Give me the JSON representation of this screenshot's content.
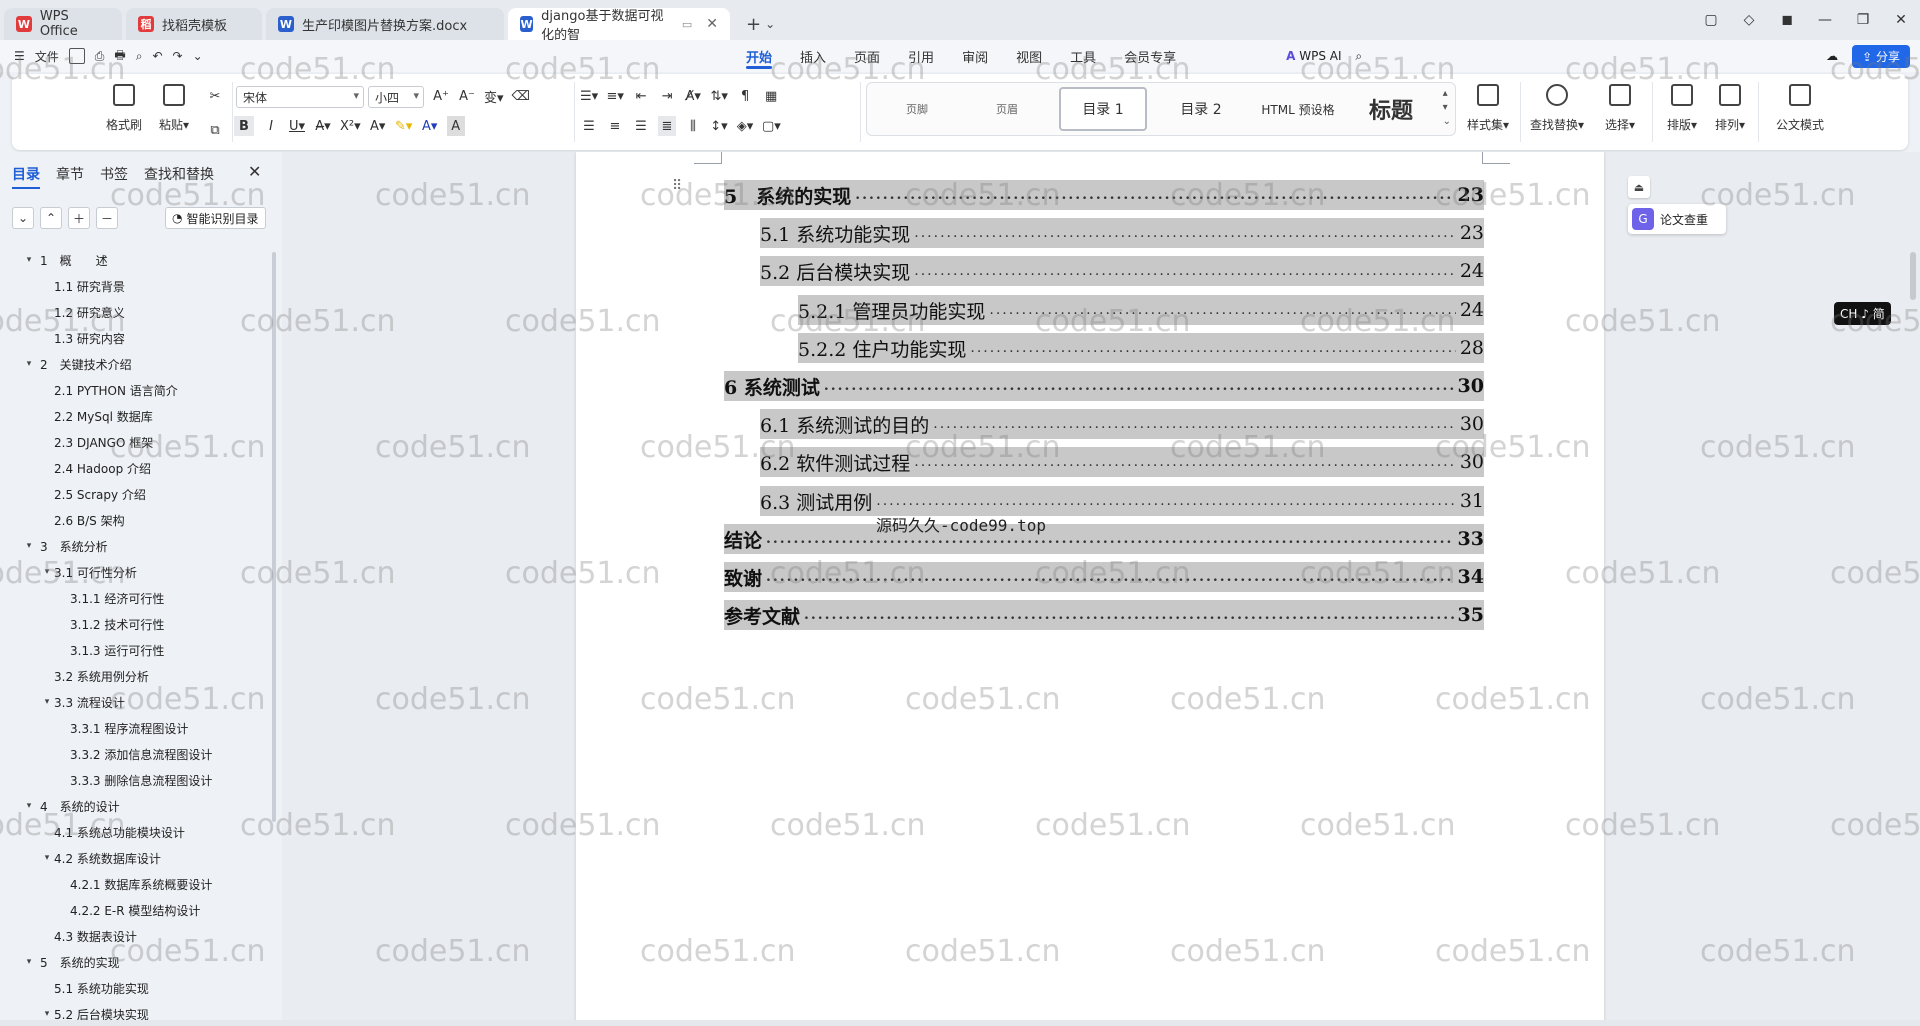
{
  "tabs": [
    {
      "label": "WPS Office",
      "logo": "W",
      "color": "#e23b3b",
      "active": false
    },
    {
      "label": "找稻壳模板",
      "logo": "稻",
      "color": "#e23b3b",
      "active": false
    },
    {
      "label": "生产印模图片替换方案.docx",
      "logo": "W",
      "color": "#2b5fce",
      "active": false
    },
    {
      "label": "django基于数据可视化的智",
      "logo": "W",
      "color": "#2b5fce",
      "active": true
    }
  ],
  "menu": {
    "file": "文件",
    "tabs": [
      "开始",
      "插入",
      "页面",
      "引用",
      "审阅",
      "视图",
      "工具",
      "会员专享"
    ],
    "wps_ai": "WPS AI",
    "share": "分享"
  },
  "ribbon": {
    "format_painter": "格式刷",
    "paste": "粘贴",
    "font_name": "宋体",
    "font_size": "小四",
    "styles": [
      "页脚",
      "页眉",
      "目录 1",
      "目录 2",
      "HTML 预设格",
      "标题"
    ],
    "style_set": "样式集",
    "find_replace": "查找替换",
    "select": "选择",
    "layout": "排版",
    "arrange": "排列",
    "official": "公文模式"
  },
  "nav": {
    "tabs": [
      "目录",
      "章节",
      "书签",
      "查找和替换"
    ],
    "smart": "智能识别目录",
    "outline": [
      {
        "text": "1　概　　述",
        "level": 1,
        "tri": true
      },
      {
        "text": "1.1 研究背景",
        "level": 2,
        "tri": false
      },
      {
        "text": "1.2 研究意义",
        "level": 2,
        "tri": false
      },
      {
        "text": "1.3 研究内容",
        "level": 2,
        "tri": false
      },
      {
        "text": "2　关键技术介绍",
        "level": 1,
        "tri": true
      },
      {
        "text": "2.1 PYTHON 语言简介",
        "level": 2,
        "tri": false
      },
      {
        "text": "2.2 MySql 数据库",
        "level": 2,
        "tri": false
      },
      {
        "text": "2.3 DJANGO 框架",
        "level": 2,
        "tri": false
      },
      {
        "text": "2.4 Hadoop 介绍",
        "level": 2,
        "tri": false
      },
      {
        "text": "2.5 Scrapy 介绍",
        "level": 2,
        "tri": false
      },
      {
        "text": "2.6 B/S 架构",
        "level": 2,
        "tri": false
      },
      {
        "text": "3　系统分析",
        "level": 1,
        "tri": true
      },
      {
        "text": "3.1 可行性分析",
        "level": 2,
        "tri": true
      },
      {
        "text": "3.1.1 经济可行性",
        "level": 3,
        "tri": false
      },
      {
        "text": "3.1.2 技术可行性",
        "level": 3,
        "tri": false
      },
      {
        "text": "3.1.3 运行可行性",
        "level": 3,
        "tri": false
      },
      {
        "text": "3.2 系统用例分析",
        "level": 2,
        "tri": false
      },
      {
        "text": "3.3 流程设计",
        "level": 2,
        "tri": true
      },
      {
        "text": "3.3.1 程序流程图设计",
        "level": 3,
        "tri": false
      },
      {
        "text": "3.3.2 添加信息流程图设计",
        "level": 3,
        "tri": false
      },
      {
        "text": "3.3.3 删除信息流程图设计",
        "level": 3,
        "tri": false
      },
      {
        "text": "4　系统的设计",
        "level": 1,
        "tri": true
      },
      {
        "text": "4.1 系统总功能模块设计",
        "level": 2,
        "tri": false
      },
      {
        "text": "4.2 系统数据库设计",
        "level": 2,
        "tri": true
      },
      {
        "text": "4.2.1 数据库系统概要设计",
        "level": 3,
        "tri": false
      },
      {
        "text": "4.2.2 E-R 模型结构设计",
        "level": 3,
        "tri": false
      },
      {
        "text": "4.3 数据表设计",
        "level": 2,
        "tri": false
      },
      {
        "text": "5　系统的实现",
        "level": 1,
        "tri": true
      },
      {
        "text": "5.1 系统功能实现",
        "level": 2,
        "tri": false
      },
      {
        "text": "5.2 后台模块实现",
        "level": 2,
        "tri": true
      }
    ]
  },
  "toc": [
    {
      "title": "5　系统的实现",
      "page": "23",
      "level": 1
    },
    {
      "title": "5.1 系统功能实现",
      "page": "23",
      "level": 2
    },
    {
      "title": "5.2 后台模块实现",
      "page": "24",
      "level": 2
    },
    {
      "title": "5.2.1 管理员功能实现",
      "page": "24",
      "level": 3
    },
    {
      "title": "5.2.2 住户功能实现",
      "page": "28",
      "level": 3
    },
    {
      "title": "6 系统测试",
      "page": "30",
      "level": 1
    },
    {
      "title": "6.1 系统测试的目的",
      "page": "30",
      "level": 2
    },
    {
      "title": "6.2 软件测试过程",
      "page": "30",
      "level": 2
    },
    {
      "title": "6.3 测试用例",
      "page": "31",
      "level": 2
    },
    {
      "title": "结论",
      "page": "33",
      "level": 1
    },
    {
      "title": "致谢",
      "page": "34",
      "level": 1
    },
    {
      "title": "参考文献",
      "page": "35",
      "level": 1
    }
  ],
  "source_note": "源码久久-code99.top",
  "side": {
    "paper_check": "论文查重",
    "ime": "CH ♪ 简"
  },
  "watermark": "code51.cn"
}
